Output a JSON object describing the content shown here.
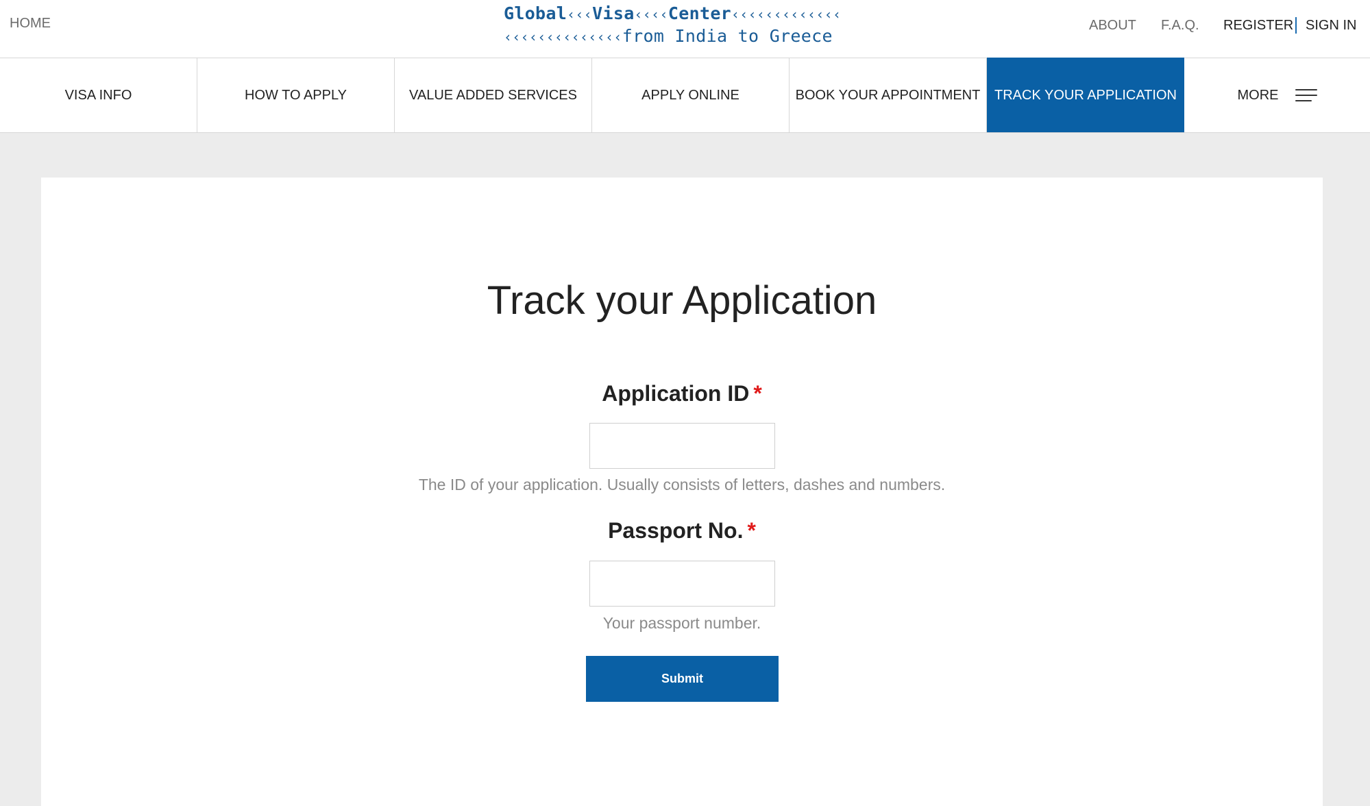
{
  "topbar": {
    "home": "HOME",
    "about": "ABOUT",
    "faq": "F.A.Q.",
    "register": "REGISTER",
    "signin": "SIGN IN"
  },
  "logo": {
    "line1_word1": "Global",
    "line1_word2": "Visa",
    "line1_word3": "Center",
    "line1_chev_a": "‹‹‹",
    "line1_chev_b": "‹‹‹‹",
    "line1_chev_c": "‹‹‹‹‹‹‹‹‹‹‹‹‹",
    "line2_chev": "‹‹‹‹‹‹‹‹‹‹‹‹‹‹",
    "line2_text": "from India to Greece"
  },
  "nav": {
    "items": [
      {
        "label": "VISA INFO"
      },
      {
        "label": "HOW TO APPLY"
      },
      {
        "label": "VALUE ADDED SERVICES"
      },
      {
        "label": "APPLY ONLINE"
      },
      {
        "label": "BOOK YOUR APPOINTMENT"
      },
      {
        "label": "TRACK YOUR APPLICATION"
      }
    ],
    "more": "MORE",
    "active_index": 5
  },
  "form": {
    "title": "Track your Application",
    "application_id": {
      "label": "Application ID",
      "required_mark": "*",
      "value": "",
      "help": "The ID of your application. Usually consists of letters, dashes and numbers."
    },
    "passport": {
      "label": "Passport No.",
      "required_mark": "*",
      "value": "",
      "help": "Your passport number."
    },
    "submit_label": "Submit"
  },
  "colors": {
    "brand_blue": "#0a60a5",
    "logo_blue": "#1a5c96",
    "required_red": "#e01b1b",
    "background": "#ececec"
  },
  "icons": {
    "menu": "hamburger-menu-icon"
  }
}
